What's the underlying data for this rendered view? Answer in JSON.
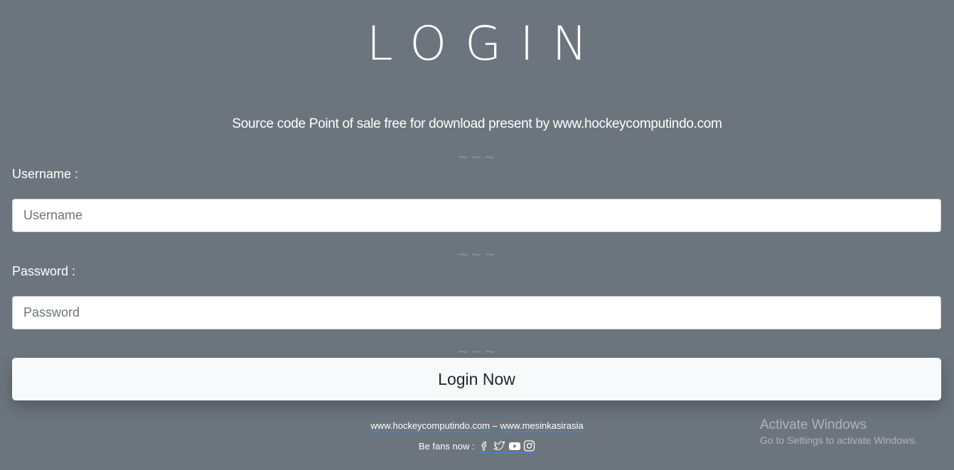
{
  "header": {
    "title": "LOGIN",
    "subtitle": "Source code Point of sale free for download present by www.hockeycomputindo.com"
  },
  "divider": "~~~",
  "form": {
    "username_label": "Username :",
    "username_placeholder": "Username",
    "username_value": "",
    "password_label": "Password :",
    "password_placeholder": "Password",
    "password_value": "",
    "submit_label": "Login Now"
  },
  "footer": {
    "link1": "www.hockeycomputindo.com",
    "separator": " – ",
    "link2": "www.mesinkasirasia",
    "fans_label": "Be fans now : ",
    "social_icons": [
      "facebook-icon",
      "twitter-icon",
      "youtube-icon",
      "instagram-icon"
    ]
  },
  "watermark": {
    "line1": "Activate Windows",
    "line2": "Go to Settings to activate Windows."
  },
  "colors": {
    "background": "#6c757d",
    "input_bg": "#ffffff",
    "button_bg": "#f8f9fa",
    "link_underline": "#4a7fd6"
  }
}
